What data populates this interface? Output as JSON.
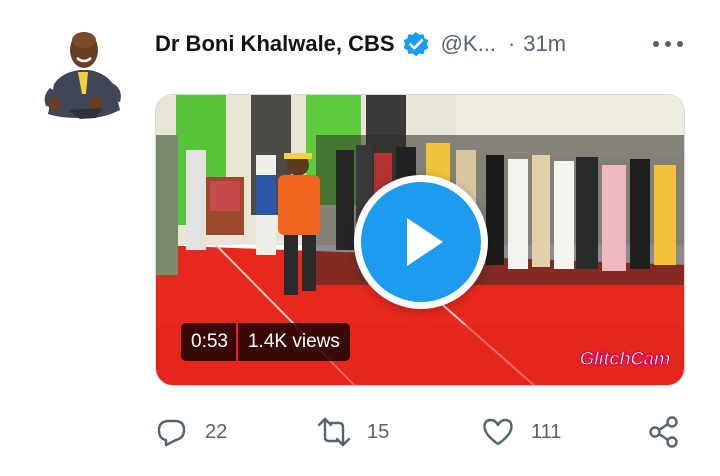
{
  "tweet": {
    "author_name": "Dr Boni Khalwale, CBS",
    "handle": "@K...",
    "separator": "·",
    "time": "31m",
    "verified": true
  },
  "video": {
    "duration": "0:53",
    "views": "1.4K views",
    "watermark": "GlitchCam"
  },
  "actions": {
    "reply_count": "22",
    "retweet_count": "15",
    "like_count": "111"
  },
  "colors": {
    "accent": "#1d9bf0",
    "secondary_text": "#536471",
    "primary_text": "#0f1419"
  },
  "icons": [
    "avatar",
    "verified-badge-icon",
    "more-options-icon",
    "play-icon",
    "reply-icon",
    "retweet-icon",
    "like-icon",
    "share-icon"
  ]
}
